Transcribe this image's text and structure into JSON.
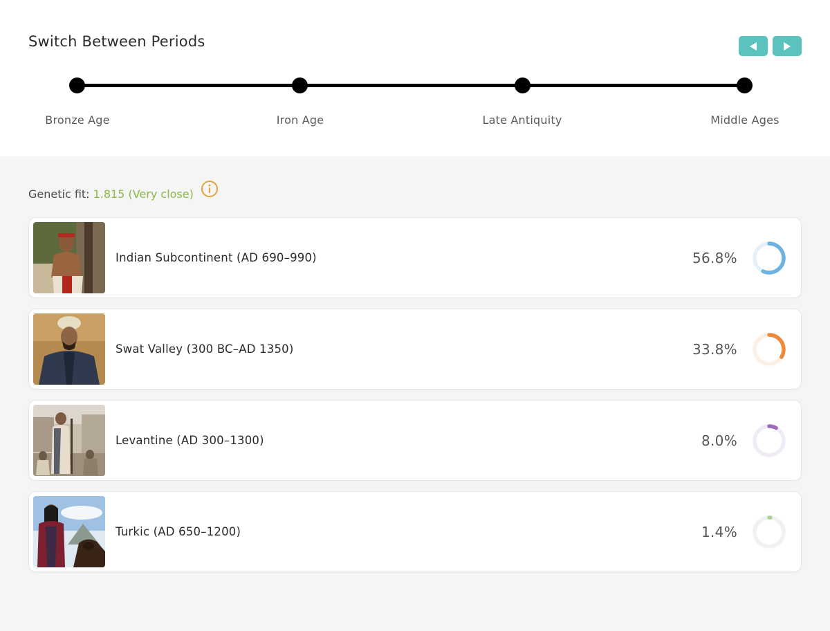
{
  "periods": {
    "title": "Switch Between Periods",
    "prev_icon": "triangle-left-icon",
    "next_icon": "triangle-right-icon",
    "accent_color": "#5cc2bd",
    "items": [
      {
        "label": "Bronze Age"
      },
      {
        "label": "Iron Age"
      },
      {
        "label": "Late Antiquity"
      },
      {
        "label": "Middle Ages"
      }
    ]
  },
  "fit": {
    "label": "Genetic fit:",
    "value": "1.815 (Very close)",
    "value_color": "#8cb84a",
    "info_icon": "info-circle-icon"
  },
  "results": [
    {
      "label": "Indian Subcontinent (AD 690–990)",
      "percent": "56.8%",
      "fraction": 0.568,
      "color": "#6db3df",
      "track": "#e4f1fa"
    },
    {
      "label": "Swat Valley (300 BC–AD 1350)",
      "percent": "33.8%",
      "fraction": 0.338,
      "color": "#ee8a3c",
      "track": "#fcefe4"
    },
    {
      "label": "Levantine (AD 300–1300)",
      "percent": "8.0%",
      "fraction": 0.08,
      "color": "#9a6dbb",
      "track": "#f1ebf6"
    },
    {
      "label": "Turkic (AD 650–1200)",
      "percent": "1.4%",
      "fraction": 0.014,
      "color": "#a6d493",
      "track": "#f0f2ef"
    }
  ]
}
